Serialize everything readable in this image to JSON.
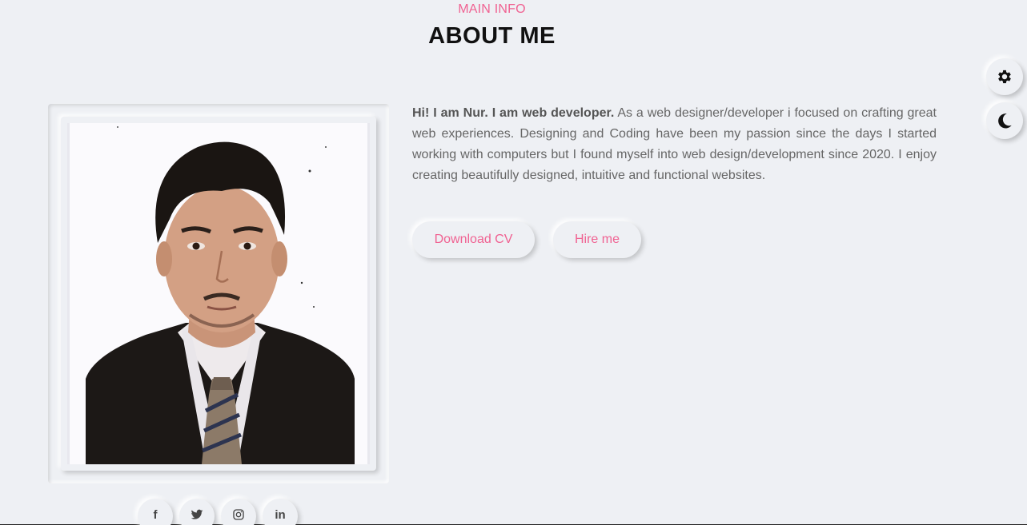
{
  "header": {
    "eyebrow": "MAIN INFO",
    "title": "ABOUT ME"
  },
  "about": {
    "intro_bold": "Hi! I am Nur. I am web developer.",
    "intro_text": " As a web designer/developer i focused on crafting great web experiences. Designing and Coding have been my passion since the days I started working with computers but I found myself into web design/development since 2020. I enjoy creating beautifully designed, intuitive and functional websites."
  },
  "buttons": {
    "download_cv": "Download CV",
    "hire_me": "Hire me"
  },
  "socials": [
    {
      "icon": "facebook-icon",
      "glyph": "f"
    },
    {
      "icon": "twitter-icon",
      "glyph": ""
    },
    {
      "icon": "instagram-icon",
      "glyph": ""
    },
    {
      "icon": "linkedin-icon",
      "glyph": "in"
    }
  ],
  "side_controls": {
    "settings_icon": "gear-icon",
    "theme_icon": "moon-icon"
  },
  "colors": {
    "accent": "#f06292",
    "background": "#eef0f4",
    "text": "#666666",
    "heading": "#111111"
  }
}
